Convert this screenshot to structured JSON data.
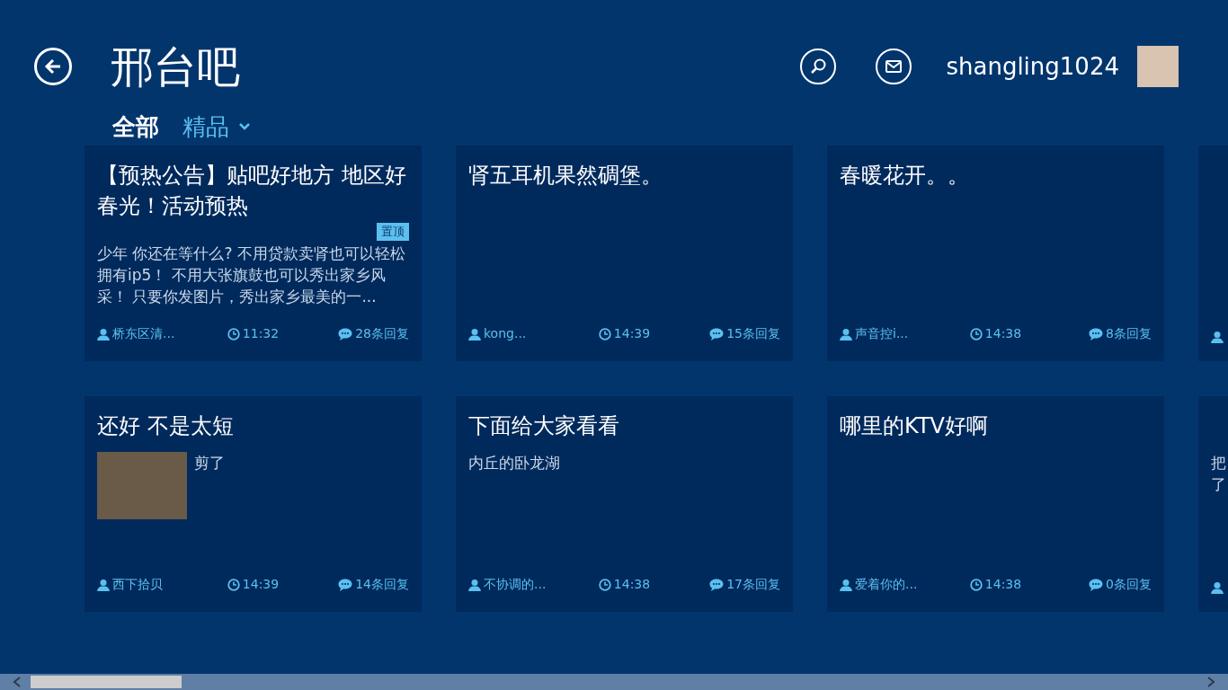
{
  "header": {
    "title": "邢台吧",
    "username": "shangling1024"
  },
  "tabs": [
    {
      "label": "全部",
      "selected": true,
      "dropdown": false
    },
    {
      "label": "精品",
      "selected": false,
      "dropdown": true
    }
  ],
  "cards": [
    {
      "kind": "full",
      "title": "【预热公告】贴吧好地方 地区好春光！活动预热",
      "badge": "置顶",
      "body": "少年 你还在等什么? 不用贷款卖肾也可以轻松拥有ip5！ 不用大张旗鼓也可以秀出家乡风采！ 只要你发图片，秀出家乡最美的一...",
      "author": "桥东区清...",
      "time": "11:32",
      "replies": "28条回复"
    },
    {
      "kind": "full",
      "title": "肾五耳机果然碉堡。",
      "author": "kong...",
      "time": "14:39",
      "replies": "15条回复"
    },
    {
      "kind": "full",
      "title": "春暖花开。。",
      "author": "声音控i...",
      "time": "14:38",
      "replies": "8条回复"
    },
    {
      "kind": "partial"
    },
    {
      "kind": "full",
      "title": "还好 不是太短",
      "photo": true,
      "body": "剪了",
      "author": "西下拾贝",
      "time": "14:39",
      "replies": "14条回复"
    },
    {
      "kind": "full",
      "title": "下面给大家看看",
      "body": "内丘的卧龙湖",
      "author": "不协调的...",
      "time": "14:38",
      "replies": "17条回复"
    },
    {
      "kind": "full",
      "title": "哪里的KTV好啊",
      "author": "爱着你的...",
      "time": "14:38",
      "replies": "0条回复"
    },
    {
      "kind": "partial",
      "body_lines": [
        "把",
        "了"
      ]
    }
  ]
}
